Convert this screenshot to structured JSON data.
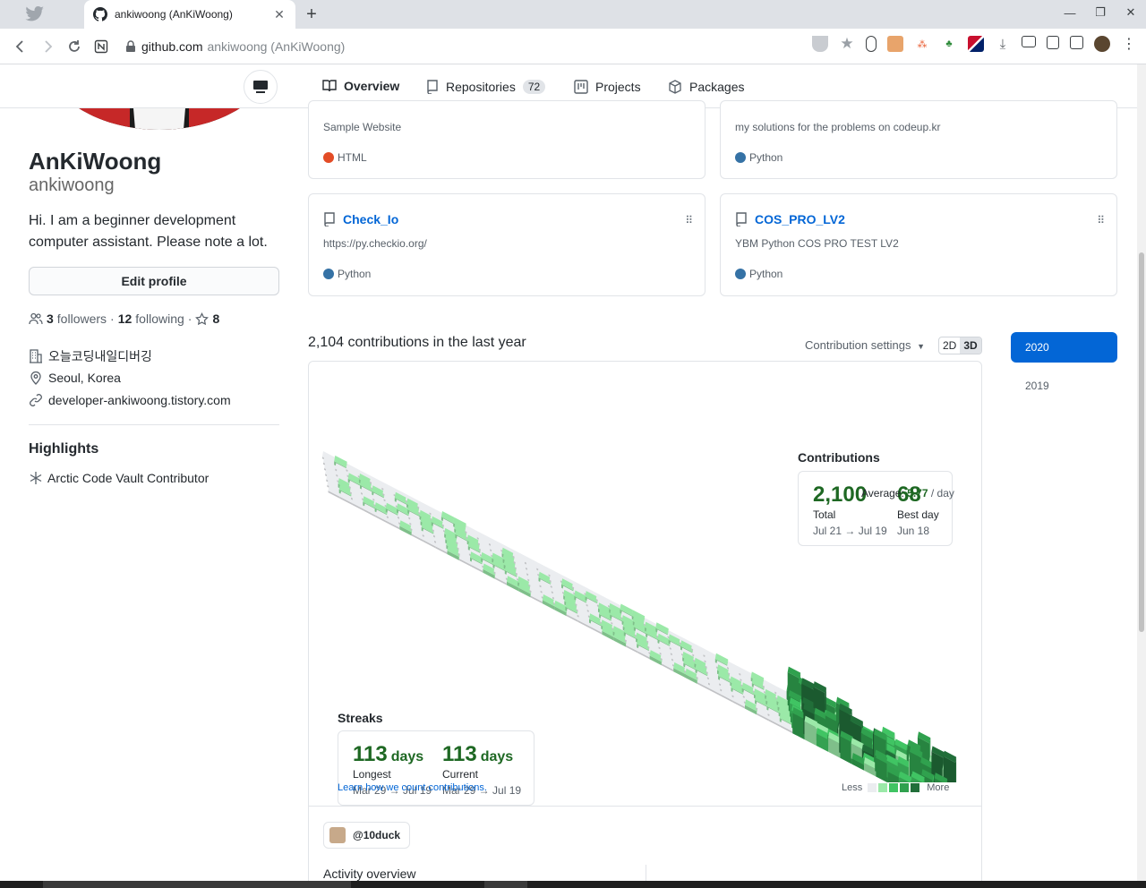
{
  "browser": {
    "tab_title": "ankiwoong (AnKiWoong)",
    "new_tab_label": "+",
    "url_host": "github.com",
    "url_path": "ankiwoong (AnKiWoong)"
  },
  "subnav": {
    "tabs": [
      {
        "label": "Overview",
        "count": ""
      },
      {
        "label": "Repositories",
        "count": "72"
      },
      {
        "label": "Projects",
        "count": ""
      },
      {
        "label": "Packages",
        "count": ""
      }
    ]
  },
  "profile": {
    "name": "AnKiWoong",
    "login": "ankiwoong",
    "bio": "Hi. I am a beginner development computer assistant. Please note a lot.",
    "edit_label": "Edit profile",
    "followers_count": "3",
    "followers_label": "followers",
    "following_count": "12",
    "following_label": "following",
    "stars_count": "8",
    "sep": "·",
    "company": "오늘코딩내일디버깅",
    "location": "Seoul, Korea",
    "website": "developer-ankiwoong.tistory.com",
    "highlights_title": "Highlights",
    "highlight": "Arctic Code Vault Contributor"
  },
  "repos": [
    {
      "name": "",
      "desc": "Sample Website",
      "lang": "HTML",
      "lang_color": "#e34c26"
    },
    {
      "name": "",
      "desc": "my solutions for the problems on codeup.kr",
      "lang": "Python",
      "lang_color": "#3572a5"
    },
    {
      "name": "Check_Io",
      "desc": "https://py.checkio.org/",
      "lang": "Python",
      "lang_color": "#3572a5"
    },
    {
      "name": "COS_PRO_LV2",
      "desc": "YBM Python COS PRO TEST LV2",
      "lang": "Python",
      "lang_color": "#3572a5"
    }
  ],
  "contributions": {
    "heading": "2,104 contributions in the last year",
    "settings_label": "Contribution settings",
    "toggle_2d": "2D",
    "toggle_3d": "3D",
    "years": [
      "2020",
      "2019"
    ],
    "stats_title": "Contributions",
    "total": "2,100",
    "total_label": "Total",
    "total_range": "Jul 21 → Jul 19",
    "best": "68",
    "best_label": "Best day",
    "best_range": "Jun 18",
    "avg_prefix": "Average:",
    "avg_value": "5.77",
    "avg_suffix": "/ day",
    "streaks_title": "Streaks",
    "longest": "113",
    "longest_label": "Longest",
    "longest_range": "Mar 29 → Jul 19",
    "current": "113",
    "current_label": "Current",
    "current_range": "Mar 29 → Jul 19",
    "days_unit": "days",
    "learn_link": "Learn how we count contributions.",
    "legend_less": "Less",
    "legend_more": "More",
    "colors": [
      "#ebedf0",
      "#9be9a8",
      "#40c463",
      "#30a14e",
      "#216e39"
    ]
  },
  "activity": {
    "org_chip": "@10duck",
    "overview_title": "Activity overview"
  }
}
